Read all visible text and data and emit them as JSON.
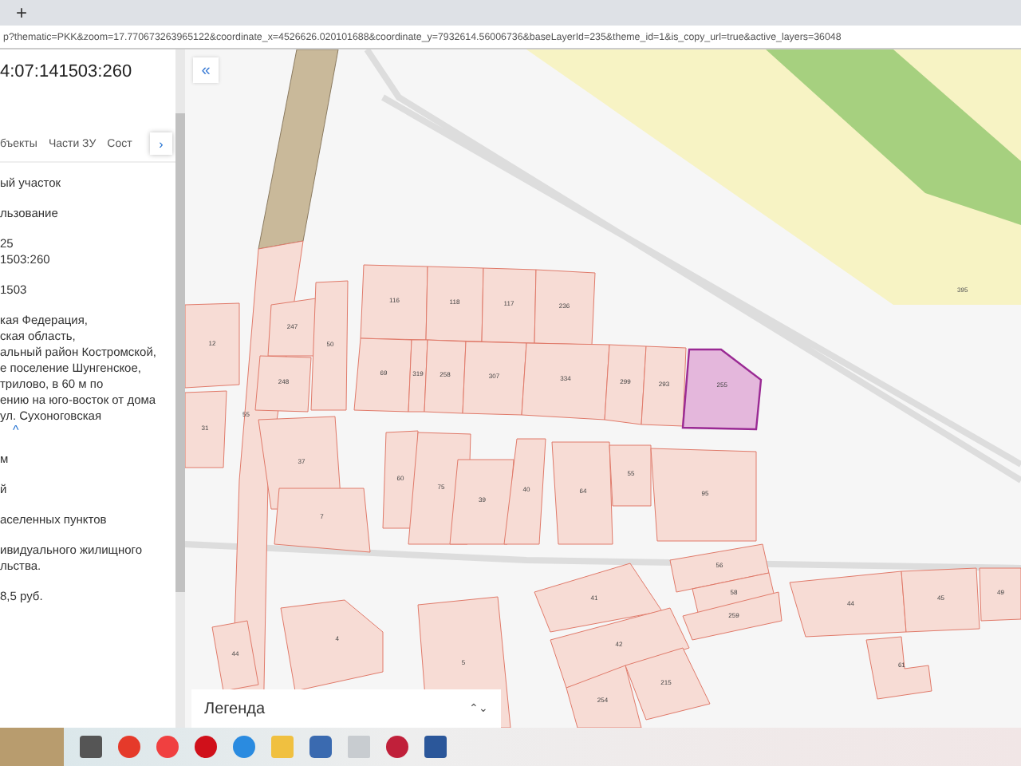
{
  "browser": {
    "new_tab": "+",
    "url": "p?thematic=PKK&zoom=17.770673263965122&coordinate_x=4526626.020101688&coordinate_y=7932614.56006736&baseLayerId=235&theme_id=1&is_copy_url=true&active_layers=36048"
  },
  "panel": {
    "title": "4:07:141503:260",
    "tabs": [
      {
        "label": "бъекты",
        "selected": false
      },
      {
        "label": "Части ЗУ",
        "selected": false
      },
      {
        "label": "Сост",
        "selected": false
      }
    ],
    "tabs_scroll": "›",
    "blocks": [
      [
        "ый участок"
      ],
      [
        "льзование"
      ],
      [
        "25",
        "1503:260"
      ],
      [
        "1503"
      ],
      [
        "кая Федерация,",
        "ская область,",
        "альный район Костромской,",
        "е поселение Шунгенское,",
        "трилово, в 60 м по",
        "ению на юго-восток от дома",
        "ул. Сухоноговская"
      ],
      [
        "м"
      ],
      [
        "й"
      ],
      [
        "аселенных пунктов"
      ],
      [
        "ивидуального жилищного",
        "льства."
      ],
      [
        "8,5 руб."
      ]
    ],
    "collapse": "^"
  },
  "map": {
    "collapse_button": "«",
    "area_label": "395",
    "parcels": [
      {
        "label": "116",
        "selected": false
      },
      {
        "label": "118",
        "selected": false
      },
      {
        "label": "117",
        "selected": false
      },
      {
        "label": "236",
        "selected": false
      },
      {
        "label": "69",
        "selected": false
      },
      {
        "label": "319",
        "selected": false
      },
      {
        "label": "258",
        "selected": false
      },
      {
        "label": "307",
        "selected": false
      },
      {
        "label": "334",
        "selected": false
      },
      {
        "label": "299",
        "selected": false
      },
      {
        "label": "293",
        "selected": false
      },
      {
        "label": "255",
        "selected": true
      },
      {
        "label": "12",
        "selected": false
      },
      {
        "label": "247",
        "selected": false
      },
      {
        "label": "50",
        "selected": false
      },
      {
        "label": "248",
        "selected": false
      },
      {
        "label": "31",
        "selected": false
      },
      {
        "label": "37",
        "selected": false
      },
      {
        "label": "7",
        "selected": false
      },
      {
        "label": "60",
        "selected": false
      },
      {
        "label": "75",
        "selected": false
      },
      {
        "label": "39",
        "selected": false
      },
      {
        "label": "40",
        "selected": false
      },
      {
        "label": "64",
        "selected": false
      },
      {
        "label": "55",
        "selected": false
      },
      {
        "label": "95",
        "selected": false
      },
      {
        "label": "41",
        "selected": false
      },
      {
        "label": "42",
        "selected": false
      },
      {
        "label": "254",
        "selected": false
      },
      {
        "label": "215",
        "selected": false
      },
      {
        "label": "56",
        "selected": false
      },
      {
        "label": "58",
        "selected": false
      },
      {
        "label": "259",
        "selected": false
      },
      {
        "label": "44",
        "selected": false
      },
      {
        "label": "45",
        "selected": false
      },
      {
        "label": "49",
        "selected": false
      },
      {
        "label": "61",
        "selected": false
      },
      {
        "label": "44",
        "selected": false
      },
      {
        "label": "4",
        "selected": false
      },
      {
        "label": "5",
        "selected": false
      }
    ],
    "road_label": "55",
    "legend": {
      "label": "Легенда",
      "toggle": "⌃⌄"
    }
  }
}
